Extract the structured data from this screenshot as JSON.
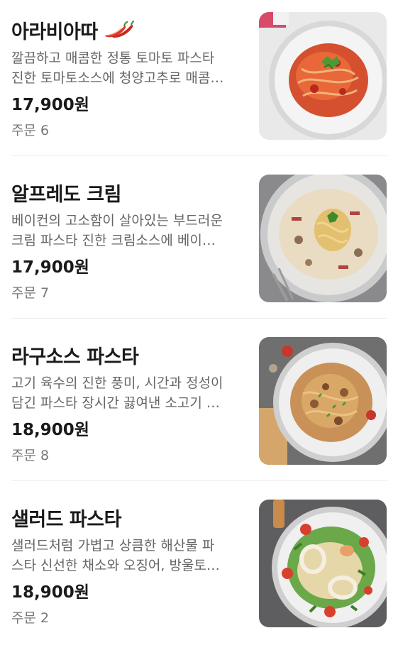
{
  "menu_items": [
    {
      "name": "아라비아따",
      "desc_line1": "깔끔하고 매콤한 정통 토마토 파스타",
      "desc_line2": "진한 토마토소스에 청양고추로 매콤…",
      "price": "17,900원",
      "orders_label": "주문",
      "orders_count": "6",
      "spicy_icon": "chili-pepper-icon",
      "image": "arrabbiata-pasta-photo"
    },
    {
      "name": "알프레도 크림",
      "desc_line1": "베이컨의 고소함이 살아있는 부드러운",
      "desc_line2": "크림 파스타 진한 크림소스에 베이…",
      "price": "17,900원",
      "orders_label": "주문",
      "orders_count": "7",
      "image": "alfredo-cream-pasta-photo"
    },
    {
      "name": "라구소스 파스타",
      "desc_line1": "고기 육수의 진한 풍미, 시간과 정성이",
      "desc_line2": "담긴 파스타 장시간 끓여낸 소고기 …",
      "price": "18,900원",
      "orders_label": "주문",
      "orders_count": "8",
      "image": "ragu-pasta-photo"
    },
    {
      "name": "샐러드 파스타",
      "desc_line1": "샐러드처럼 가볍고 상큼한 해산물 파",
      "desc_line2": "스타 신선한 채소와 오징어, 방울토…",
      "price": "18,900원",
      "orders_label": "주문",
      "orders_count": "2",
      "image": "salad-pasta-photo"
    }
  ],
  "colors": {
    "text_primary": "#1a1a1a",
    "text_secondary": "#666666",
    "divider": "#ededed",
    "spicy": "#e0392b"
  }
}
